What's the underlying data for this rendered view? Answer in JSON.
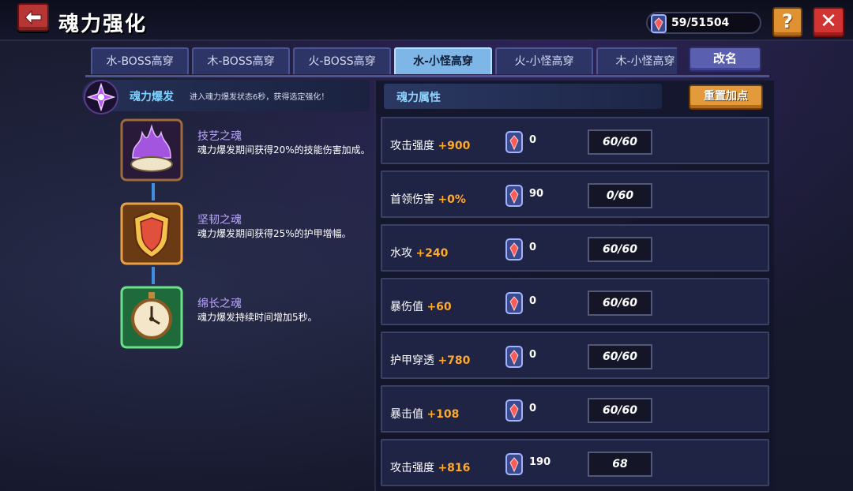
{
  "header": {
    "title": "魂力强化",
    "currency_value": "59/51504",
    "help_label": "?",
    "close_label": "✕"
  },
  "tabs": [
    {
      "label": "水-BOSS高穿",
      "active": false
    },
    {
      "label": "木-BOSS高穿",
      "active": false
    },
    {
      "label": "火-BOSS高穿",
      "active": false
    },
    {
      "label": "水-小怪高穿",
      "active": true
    },
    {
      "label": "火-小怪高穿",
      "active": false
    },
    {
      "label": "木-小怪高穿",
      "active": false
    }
  ],
  "rename_label": "改名",
  "burst": {
    "title": "魂力爆发",
    "description": "进入魂力爆发状态6秒，获得选定强化！"
  },
  "skills": [
    {
      "name": "技艺之魂",
      "desc": "魂力爆发期间获得20%的技能伤害加成。",
      "icon": "purple-flame-icon"
    },
    {
      "name": "坚韧之魂",
      "desc": "魂力爆发期间获得25%的护甲增幅。",
      "icon": "shield-icon"
    },
    {
      "name": "绵长之魂",
      "desc": "魂力爆发持续时间增加5秒。",
      "icon": "stopwatch-icon"
    }
  ],
  "attributes": {
    "title": "魂力属性",
    "reset_label": "重置加点",
    "rows": [
      {
        "label": "攻击强度",
        "bonus": "+900",
        "count": "0",
        "level": "60/60"
      },
      {
        "label": "首领伤害",
        "bonus": "+0%",
        "count": "90",
        "level": "0/60"
      },
      {
        "label": "水攻",
        "bonus": "+240",
        "count": "0",
        "level": "60/60"
      },
      {
        "label": "暴伤值",
        "bonus": "+60",
        "count": "0",
        "level": "60/60"
      },
      {
        "label": "护甲穿透",
        "bonus": "+780",
        "count": "0",
        "level": "60/60"
      },
      {
        "label": "暴击值",
        "bonus": "+108",
        "count": "0",
        "level": "60/60"
      },
      {
        "label": "攻击强度",
        "bonus": "+816",
        "count": "190",
        "level": "68"
      }
    ]
  },
  "colors": {
    "accent_bonus": "#ffaa2a",
    "tab_active": "#7fb6e8",
    "close_red": "#d23434",
    "help_orange": "#e09232"
  }
}
